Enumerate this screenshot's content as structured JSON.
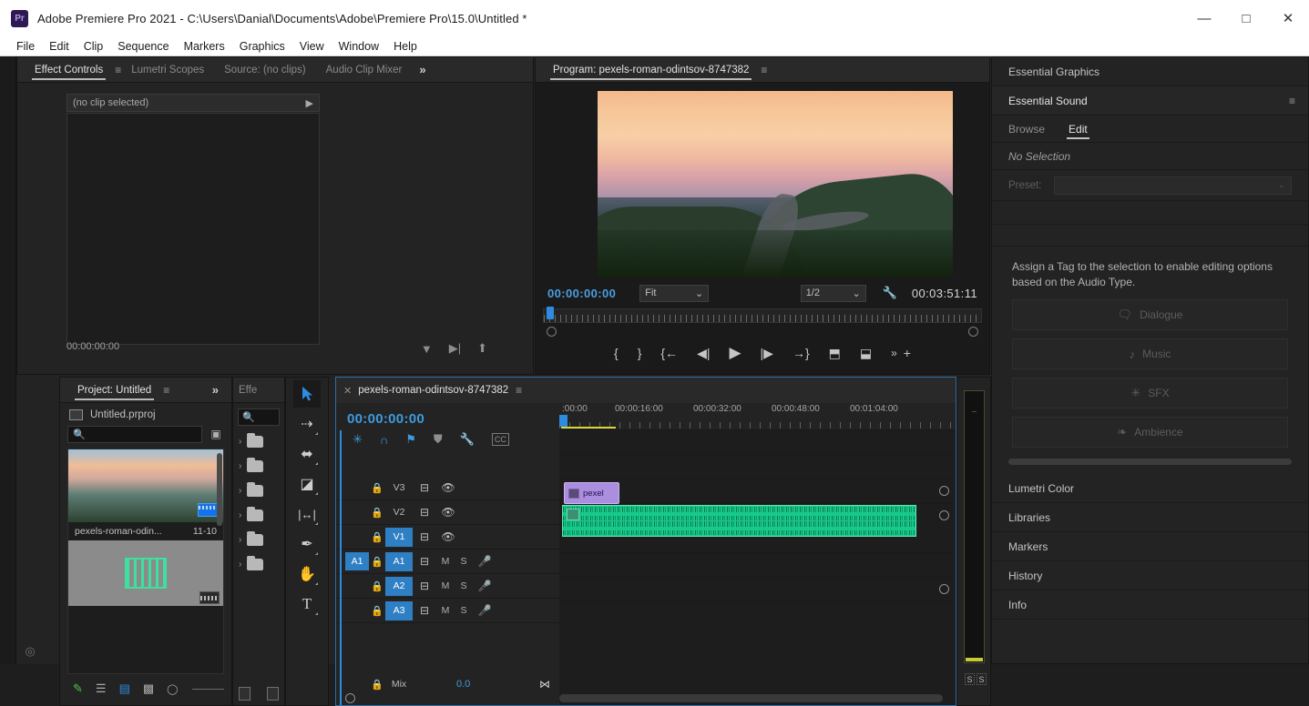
{
  "titlebar": {
    "app_badge": "Pr",
    "title": "Adobe Premiere Pro 2021 - C:\\Users\\Danial\\Documents\\Adobe\\Premiere Pro\\15.0\\Untitled *",
    "minimize": "—",
    "maximize": "□",
    "close": "✕"
  },
  "menubar": {
    "items": [
      "File",
      "Edit",
      "Clip",
      "Sequence",
      "Markers",
      "Graphics",
      "View",
      "Window",
      "Help"
    ]
  },
  "effect_controls": {
    "tabs": [
      {
        "label": "Effect Controls",
        "active": true
      },
      {
        "label": "Lumetri Scopes",
        "active": false
      },
      {
        "label": "Source: (no clips)",
        "active": false
      },
      {
        "label": "Audio Clip Mixer",
        "active": false
      }
    ],
    "overflow": "»",
    "menu_icon": "≡",
    "clip_status": "(no clip selected)",
    "expand_arrow": "▶",
    "timecode": "00:00:00:00",
    "tool_icons": [
      "funnel-icon",
      "play-in-to-out-icon",
      "export-icon"
    ]
  },
  "program_monitor": {
    "tab_label": "Program: pexels-roman-odintsov-8747382",
    "menu_icon": "≡",
    "playhead_timecode": "00:00:00:00",
    "fit_value": "Fit",
    "resolution_value": "1/2",
    "settings_icon": "wrench-icon",
    "duration_timecode": "00:03:51:11",
    "transport": [
      {
        "name": "mark-in-button",
        "glyph": "{"
      },
      {
        "name": "mark-out-button",
        "glyph": "}"
      },
      {
        "name": "go-to-in-button",
        "glyph": "{←"
      },
      {
        "name": "step-back-button",
        "glyph": "◀|"
      },
      {
        "name": "play-button",
        "glyph": "▶"
      },
      {
        "name": "step-forward-button",
        "glyph": "|▶"
      },
      {
        "name": "go-to-out-button",
        "glyph": "→}"
      },
      {
        "name": "lift-button",
        "glyph": "⬒"
      },
      {
        "name": "extract-button",
        "glyph": "⬓"
      },
      {
        "name": "more-button",
        "glyph": "»"
      },
      {
        "name": "button-editor-button",
        "glyph": "+"
      }
    ]
  },
  "right_panel": {
    "essential_graphics": "Essential Graphics",
    "essential_sound": "Essential Sound",
    "menu_icon": "≡",
    "subtabs": [
      {
        "label": "Browse",
        "active": false
      },
      {
        "label": "Edit",
        "active": true
      }
    ],
    "no_selection": "No Selection",
    "preset_label": "Preset:",
    "preset_value": "",
    "help_text": "Assign a Tag to the selection to enable editing options based on the Audio Type.",
    "tags": [
      {
        "label": "Dialogue",
        "icon": "speech-bubble-icon",
        "glyph": "🗨"
      },
      {
        "label": "Music",
        "icon": "music-note-icon",
        "glyph": "♪"
      },
      {
        "label": "SFX",
        "icon": "burst-icon",
        "glyph": "✳"
      },
      {
        "label": "Ambience",
        "icon": "leaf-icon",
        "glyph": "❧"
      }
    ],
    "collapsed_panels": [
      "Lumetri Color",
      "Libraries",
      "Markers",
      "History",
      "Info"
    ]
  },
  "project_panel": {
    "tab_label": "Project: Untitled",
    "menu_icon": "≡",
    "overflow": "»",
    "effects_tab": "Effe",
    "file_name": "Untitled.prproj",
    "search_placeholder": "",
    "new_bin_icon": "new-bin-icon",
    "items": [
      {
        "name": "pexels-roman-odin...",
        "duration": "11-10",
        "type": "video"
      },
      {
        "name": "",
        "duration": "",
        "type": "audio"
      }
    ],
    "footer_icons": [
      "pen-icon",
      "list-view-icon",
      "icon-view-icon",
      "freeform-view-icon",
      "zoom-slider"
    ]
  },
  "effects_panel": {
    "search_icon": "search-icon",
    "folder_count": 6,
    "footer_icons": [
      "new-preset-icon",
      "delete-icon"
    ]
  },
  "tools_panel": {
    "tools": [
      {
        "name": "selection-tool",
        "glyph": "➤",
        "active": true
      },
      {
        "name": "track-select-forward-tool",
        "glyph": "⇥",
        "active": false
      },
      {
        "name": "ripple-edit-tool",
        "glyph": "↔",
        "active": false
      },
      {
        "name": "razor-tool",
        "glyph": "◪",
        "active": false
      },
      {
        "name": "slip-tool",
        "glyph": "|↔|",
        "active": false
      },
      {
        "name": "pen-tool",
        "glyph": "✎",
        "active": false
      },
      {
        "name": "hand-tool",
        "glyph": "✋",
        "active": false
      },
      {
        "name": "type-tool",
        "glyph": "T",
        "active": false
      }
    ]
  },
  "timeline": {
    "close_icon": "✕",
    "sequence_name": "pexels-roman-odintsov-8747382",
    "menu_icon": "≡",
    "timecode": "00:00:00:00",
    "tool_icons": [
      {
        "name": "insert-overwrite-icon",
        "glyph": "✳"
      },
      {
        "name": "snap-icon",
        "glyph": "∩"
      },
      {
        "name": "linked-selection-icon",
        "glyph": "⚑"
      },
      {
        "name": "marker-icon",
        "glyph": "⛊"
      },
      {
        "name": "timeline-settings-icon",
        "glyph": "🔧"
      },
      {
        "name": "captions-icon",
        "glyph": "CC"
      }
    ],
    "ruler_labels": [
      ":00:00",
      "00:00:16:00",
      "00:00:32:00",
      "00:00:48:00",
      "00:01:04:00"
    ],
    "tracks": [
      {
        "name": "V3",
        "type": "video",
        "targeted": false,
        "source_patch": ""
      },
      {
        "name": "V2",
        "type": "video",
        "targeted": false,
        "source_patch": ""
      },
      {
        "name": "V1",
        "type": "video",
        "targeted": true,
        "source_patch": ""
      },
      {
        "name": "A1",
        "type": "audio",
        "targeted": true,
        "source_patch": "A1"
      },
      {
        "name": "A2",
        "type": "audio",
        "targeted": true,
        "source_patch": ""
      },
      {
        "name": "A3",
        "type": "audio",
        "targeted": true,
        "source_patch": ""
      }
    ],
    "track_controls": {
      "lock": "🔒",
      "sync": "⊟",
      "eye": "👁",
      "mute": "M",
      "solo": "S",
      "voiceover": "🎙"
    },
    "mix_label": "Mix",
    "mix_value": "0.0",
    "clips": {
      "video_clip_label": "pexel",
      "audio_clip_label": ""
    }
  },
  "meters": {
    "solo_left": "S",
    "solo_right": "S"
  },
  "rail": {
    "home_icon": "home-icon",
    "bottom_icon": "settings-icon"
  }
}
